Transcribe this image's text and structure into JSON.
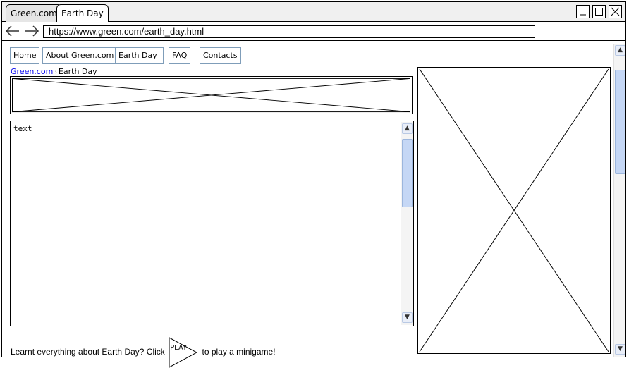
{
  "browser": {
    "tabs": [
      {
        "label": "Green.com",
        "active": false
      },
      {
        "label": "Earth Day",
        "active": true
      }
    ],
    "url": "https://www.green.com/earth_day.html",
    "window_buttons": [
      "minimize-icon",
      "maximize-icon",
      "close-icon"
    ]
  },
  "nav": {
    "items": [
      {
        "label": "Home"
      },
      {
        "label": "About Green.com"
      },
      {
        "label": "Earth Day"
      },
      {
        "label": "FAQ"
      },
      {
        "label": "Contacts"
      }
    ]
  },
  "breadcrumb": {
    "parent": "Green.com",
    "separator": "›",
    "current": "Earth Day"
  },
  "main": {
    "text": "text"
  },
  "footer": {
    "prefix": "Learnt everything about Earth Day? Click",
    "play_label": "PLAY",
    "suffix": "to play a minigame!"
  },
  "colors": {
    "link": "#0000ee",
    "nav_border": "#7f9db9",
    "scroll_thumb": "#c5d7f5"
  }
}
